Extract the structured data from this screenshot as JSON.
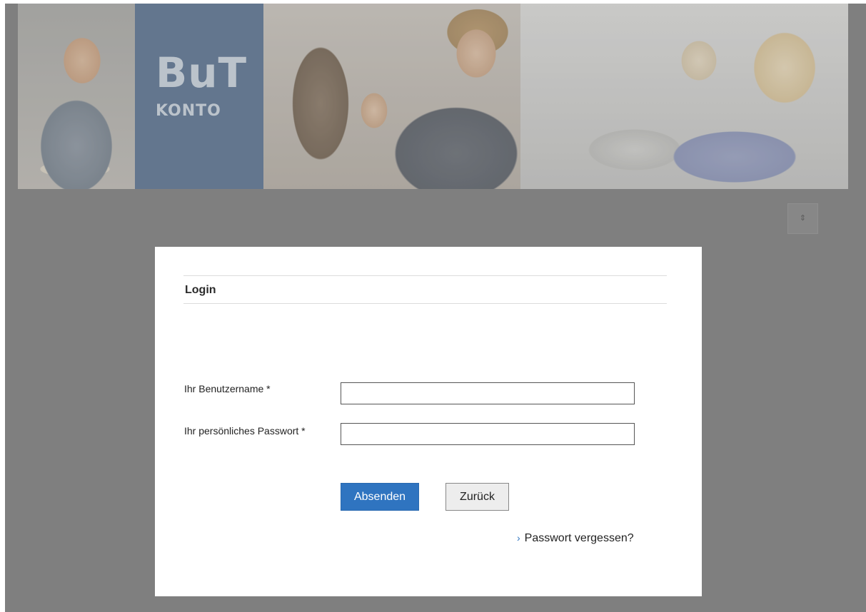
{
  "banner": {
    "logo_title": "BuT",
    "logo_subtitle": "KONTO"
  },
  "corner_button": {
    "glyph": "⇕"
  },
  "login": {
    "title": "Login",
    "username_label": "Ihr Benutzername *",
    "username_value": "",
    "password_label": "Ihr persönliches Passwort *",
    "password_value": "",
    "submit_label": "Absenden",
    "back_label": "Zurück",
    "forgot_chevron": "›",
    "forgot_label": "Passwort vergessen?"
  },
  "colors": {
    "primary_button": "#2f74c0",
    "overlay": "#7f7f7f",
    "logo_block": "#5d7592"
  }
}
